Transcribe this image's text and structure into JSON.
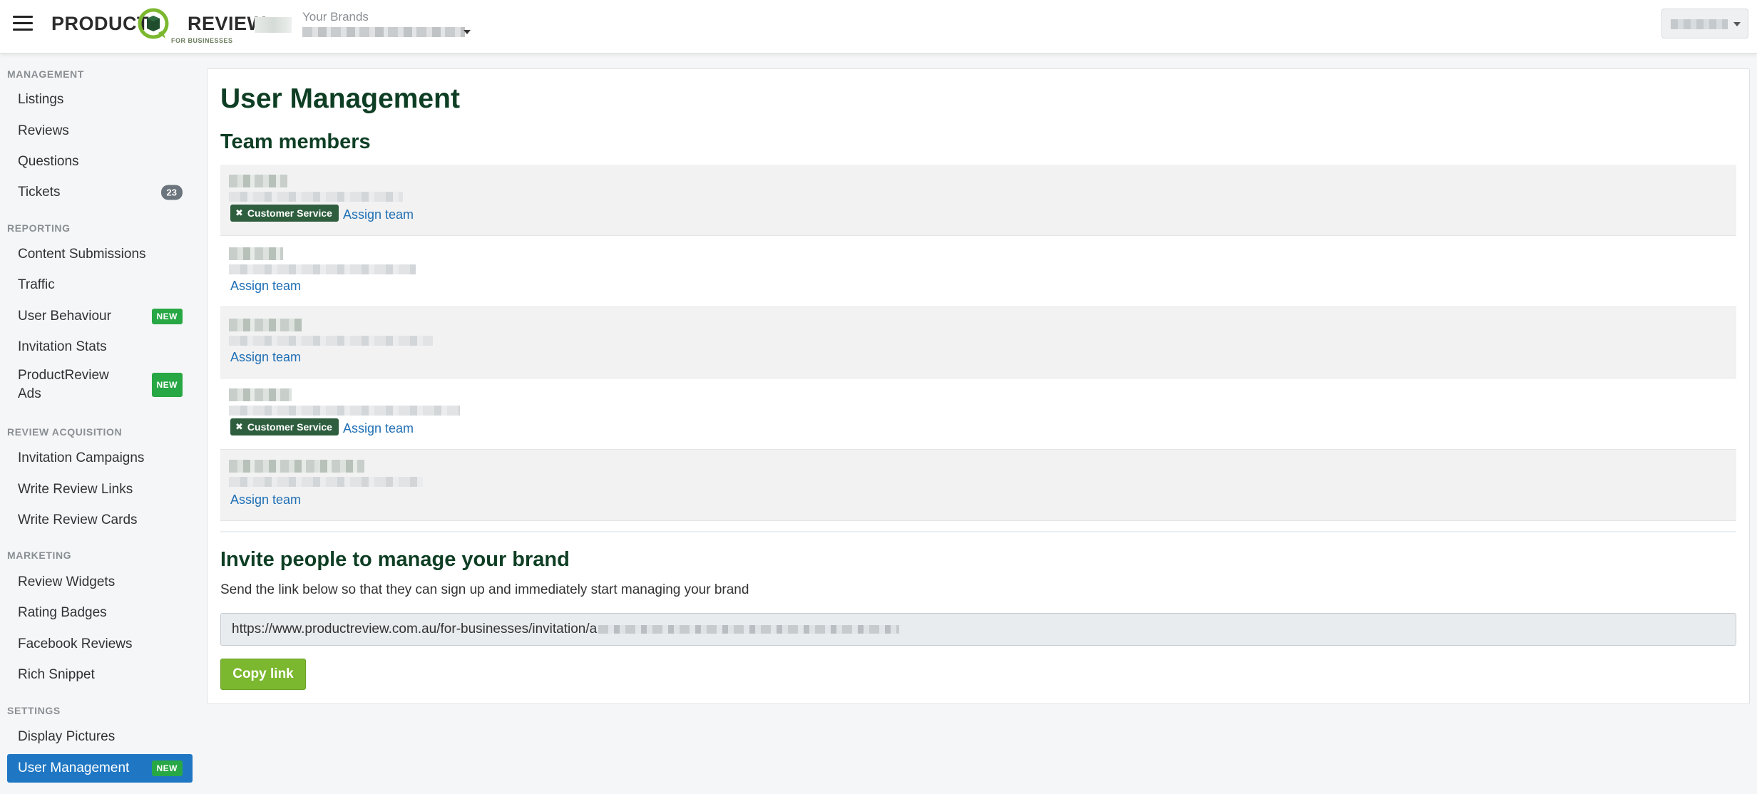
{
  "header": {
    "logo_word1": "PRODUCT",
    "logo_word2": "REVIEW",
    "logo_sub": "FOR BUSINESSES",
    "brands_label": "Your Brands"
  },
  "sidebar": {
    "sections": {
      "management": "MANAGEMENT",
      "reporting": "REPORTING",
      "review_acquisition": "REVIEW ACQUISITION",
      "marketing": "MARKETING",
      "settings": "SETTINGS"
    },
    "items": {
      "listings": "Listings",
      "reviews": "Reviews",
      "questions": "Questions",
      "tickets": "Tickets",
      "tickets_count": "23",
      "content_submissions": "Content Submissions",
      "traffic": "Traffic",
      "user_behaviour": "User Behaviour",
      "invitation_stats": "Invitation Stats",
      "productreview_ads": "ProductReview Ads",
      "invitation_campaigns": "Invitation Campaigns",
      "write_review_links": "Write Review Links",
      "write_review_cards": "Write Review Cards",
      "review_widgets": "Review Widgets",
      "rating_badges": "Rating Badges",
      "facebook_reviews": "Facebook Reviews",
      "rich_snippet": "Rich Snippet",
      "display_pictures": "Display Pictures",
      "user_management": "User Management"
    },
    "new_badge": "NEW"
  },
  "main": {
    "page_title": "User Management",
    "team_title": "Team members",
    "team_tag": "Customer Service",
    "assign_label": "Assign team",
    "invite_title": "Invite people to manage your brand",
    "invite_desc": "Send the link below so that they can sign up and immediately start managing your brand",
    "invite_url": "https://www.productreview.com.au/for-businesses/invitation/a",
    "copy_button": "Copy link"
  },
  "colors": {
    "accent_green": "#7cb82f",
    "heading_green": "#0e3e24",
    "link_blue": "#1f6fb5",
    "active_blue": "#1f77c4",
    "badge_new": "#28a745",
    "team_tag": "#2e5e3e"
  }
}
